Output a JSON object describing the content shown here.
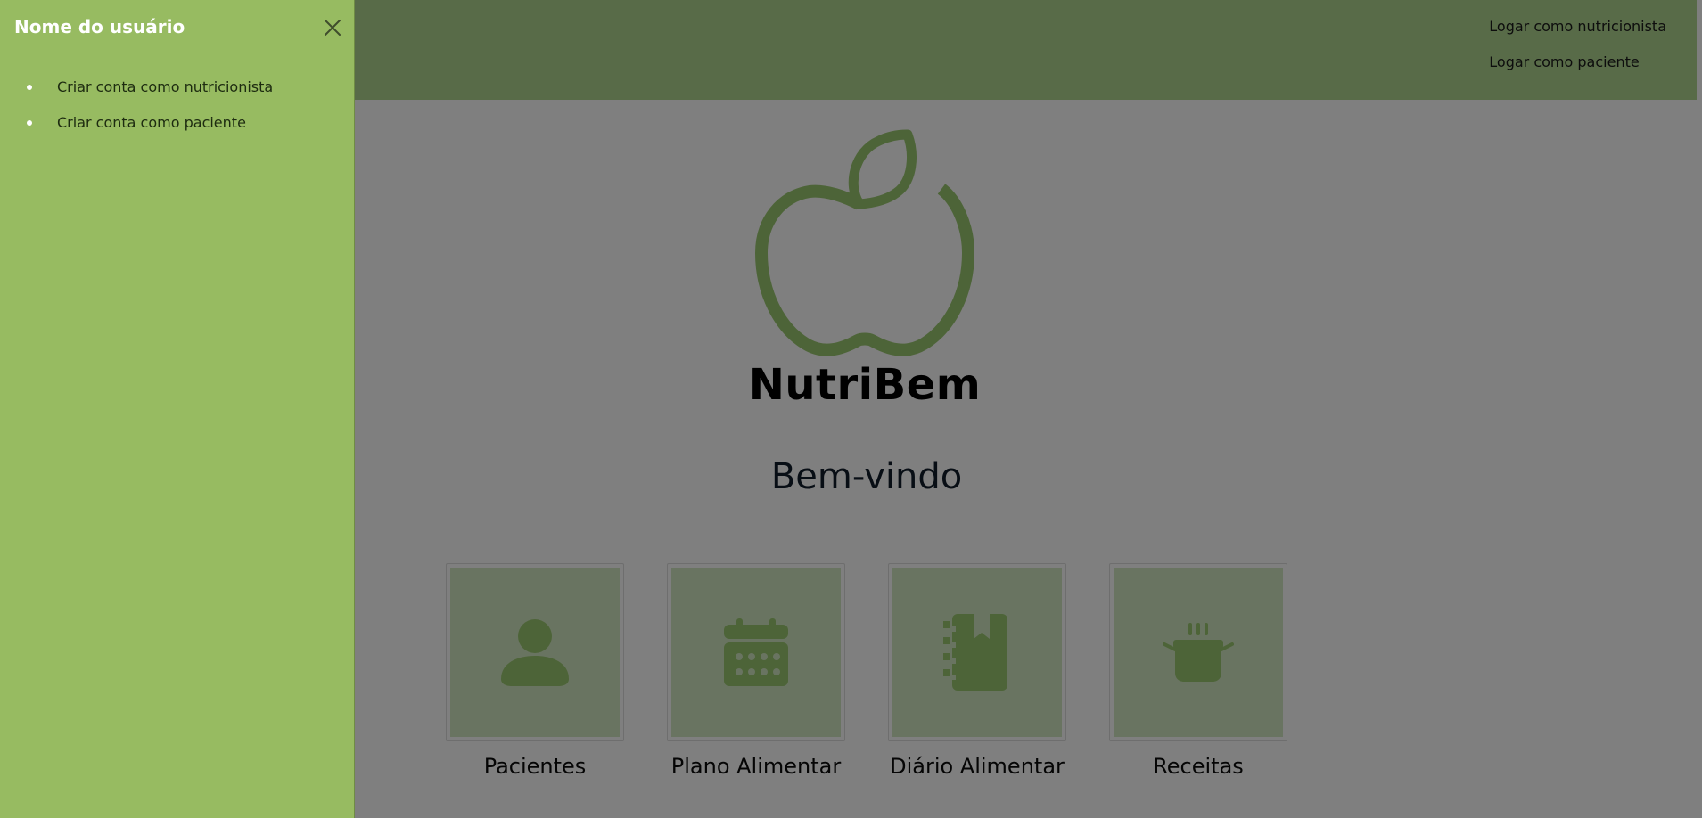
{
  "header": {
    "links": [
      {
        "label": "Logar como nutricionista"
      },
      {
        "label": "Logar como paciente"
      }
    ]
  },
  "brand": {
    "name": "NutriBem",
    "logo_icon": "apple-icon",
    "logo_color": "#4e6537"
  },
  "main": {
    "welcome": "Bem-vindo",
    "cards": [
      {
        "label": "Pacientes",
        "icon": "person-icon"
      },
      {
        "label": "Plano Alimentar",
        "icon": "calendar-icon"
      },
      {
        "label": "Diário Alimentar",
        "icon": "notebook-icon"
      },
      {
        "label": "Receitas",
        "icon": "cooking-pot-icon"
      }
    ]
  },
  "drawer": {
    "title": "Nome do usuário",
    "close_icon": "close-icon",
    "items": [
      {
        "label": "Criar conta como nutricionista"
      },
      {
        "label": "Criar conta como paciente"
      }
    ]
  },
  "colors": {
    "drawer_bg": "#97bb61",
    "topbar_bg": "#b1d690",
    "icon_green": "#4e6537",
    "card_bg": "#d3e8c2",
    "overlay": "rgba(0,0,0,0.5)"
  }
}
